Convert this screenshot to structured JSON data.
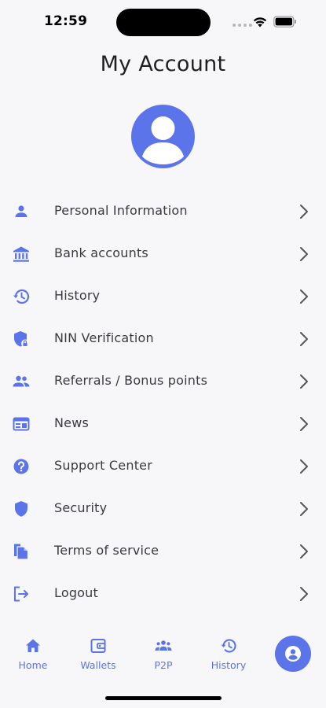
{
  "status_bar": {
    "time": "12:59"
  },
  "header": {
    "title": "My Account"
  },
  "menu": {
    "items": [
      {
        "label": "Personal Information",
        "icon": "person-icon"
      },
      {
        "label": "Bank accounts",
        "icon": "bank-icon"
      },
      {
        "label": "History",
        "icon": "history-icon"
      },
      {
        "label": "NIN Verification",
        "icon": "shield-lock-icon"
      },
      {
        "label": "Referrals / Bonus points",
        "icon": "group-icon"
      },
      {
        "label": "News",
        "icon": "news-icon"
      },
      {
        "label": "Support Center",
        "icon": "help-icon"
      },
      {
        "label": "Security",
        "icon": "shield-icon"
      },
      {
        "label": "Terms of service",
        "icon": "document-icon"
      },
      {
        "label": "Logout",
        "icon": "logout-icon"
      }
    ]
  },
  "bottom_nav": {
    "items": [
      {
        "label": "Home",
        "icon": "home-icon"
      },
      {
        "label": "Wallets",
        "icon": "wallet-icon"
      },
      {
        "label": "P2P",
        "icon": "group-icon"
      },
      {
        "label": "History",
        "icon": "history-icon"
      }
    ],
    "active": "profile-icon"
  },
  "colors": {
    "accent": "#5b74ea",
    "background": "#f7f7f9",
    "text": "#3a3a40"
  }
}
